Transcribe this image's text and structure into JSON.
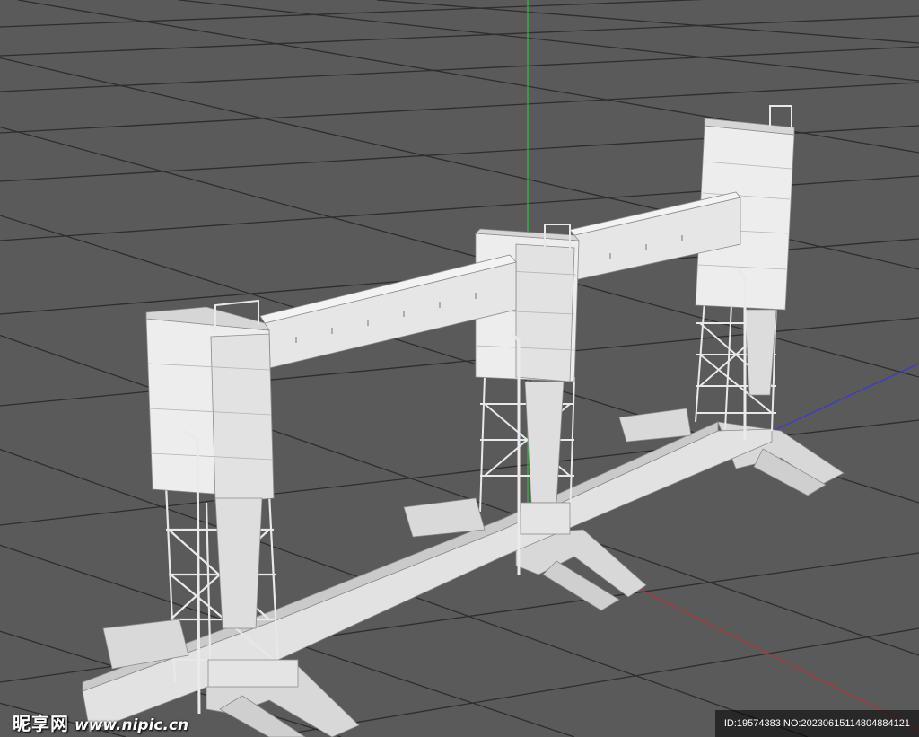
{
  "viewport": {
    "description_label": "3D viewport",
    "background_color": "#5a5a5a",
    "grid_color": "#2e2e2e",
    "axis_colors": {
      "y": "#2fbf3a",
      "x": "#b83030",
      "z": "#3a3ad0"
    },
    "model_color": "#e6e6e6"
  },
  "watermark": {
    "brand": "昵享网",
    "url": "www.nipic.cn",
    "id_text": "ID:19574383 NO:20230615114804884121"
  }
}
